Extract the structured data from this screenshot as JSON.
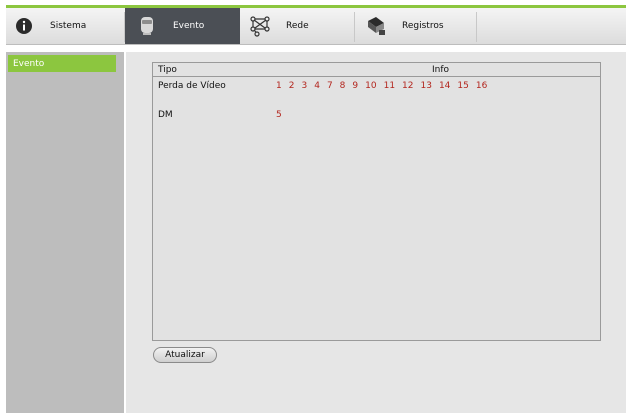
{
  "tabs": [
    {
      "label": "Sistema",
      "icon": "info-icon"
    },
    {
      "label": "Evento",
      "icon": "camera-icon"
    },
    {
      "label": "Rede",
      "icon": "network-icon"
    },
    {
      "label": "Registros",
      "icon": "log-icon"
    }
  ],
  "active_tab": "Evento",
  "sidebar": {
    "items": [
      {
        "label": "Evento",
        "selected": true
      }
    ]
  },
  "table": {
    "headers": {
      "type": "Tipo",
      "info": "Info"
    },
    "rows": [
      {
        "type": "Perda de Vídeo",
        "info": [
          "1",
          "2",
          "3",
          "4",
          "7",
          "8",
          "9",
          "10",
          "11",
          "12",
          "13",
          "14",
          "15",
          "16"
        ]
      },
      {
        "type": "DM",
        "info": [
          "5"
        ]
      }
    ]
  },
  "refresh_button": "Atualizar",
  "colors": {
    "accent": "#8cc63f",
    "active_tab": "#4b4f55",
    "channel_number": "#b3261e"
  }
}
